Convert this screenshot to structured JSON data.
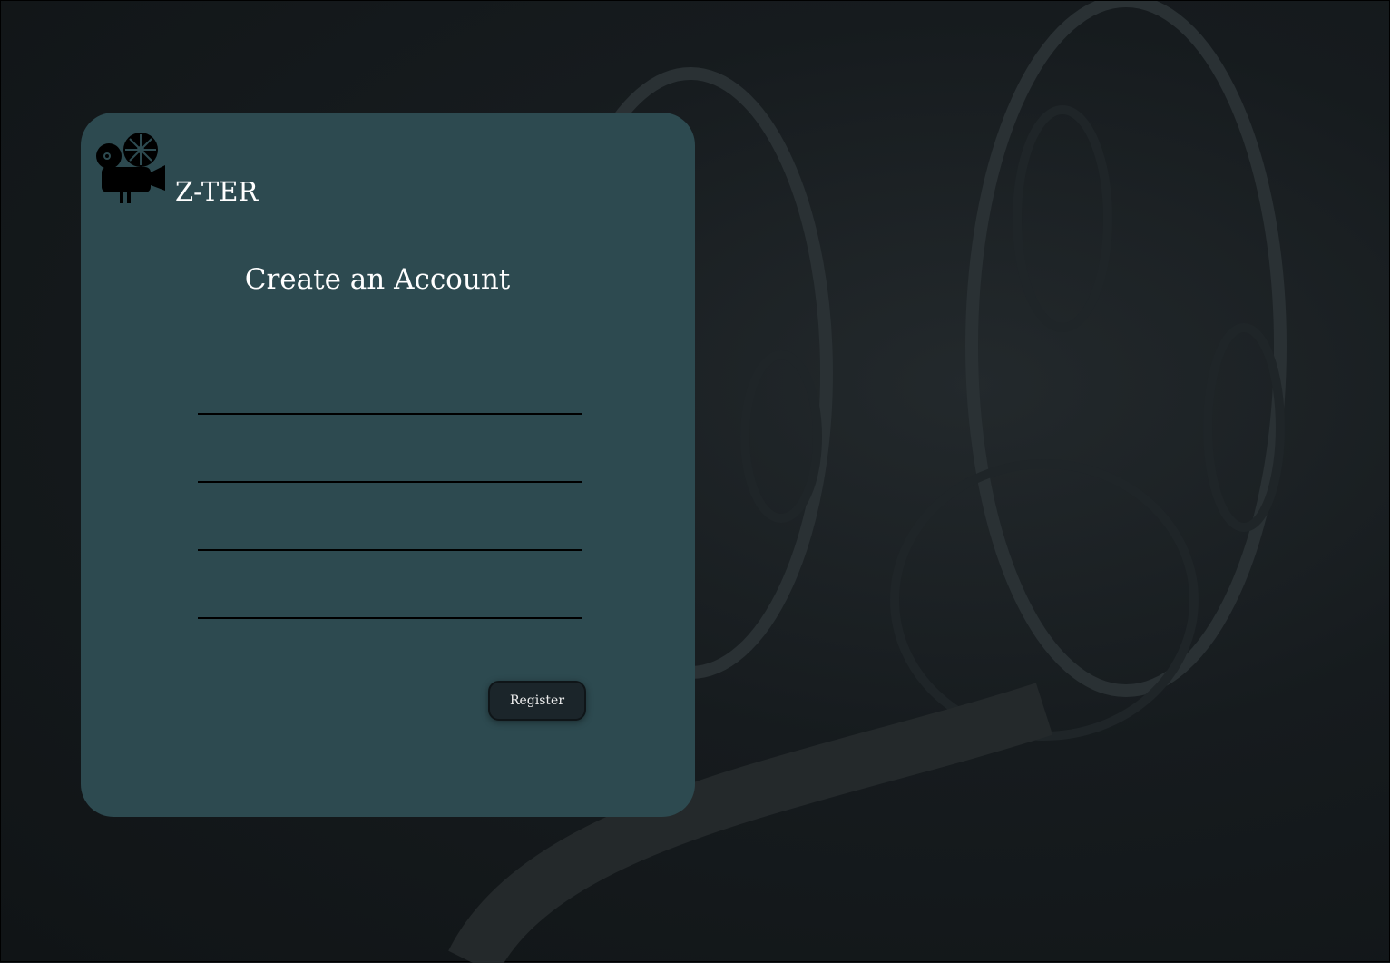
{
  "brand": {
    "name": "Z-TER",
    "logo_icon": "film-projector-icon"
  },
  "form": {
    "title": "Create an Account",
    "fields": [
      {
        "value": "",
        "placeholder": ""
      },
      {
        "value": "",
        "placeholder": ""
      },
      {
        "value": "",
        "placeholder": ""
      },
      {
        "value": "",
        "placeholder": ""
      }
    ],
    "register_label": "Register"
  },
  "colors": {
    "card": "#2d4a50",
    "button": "#1b252a",
    "background": "#121619"
  }
}
